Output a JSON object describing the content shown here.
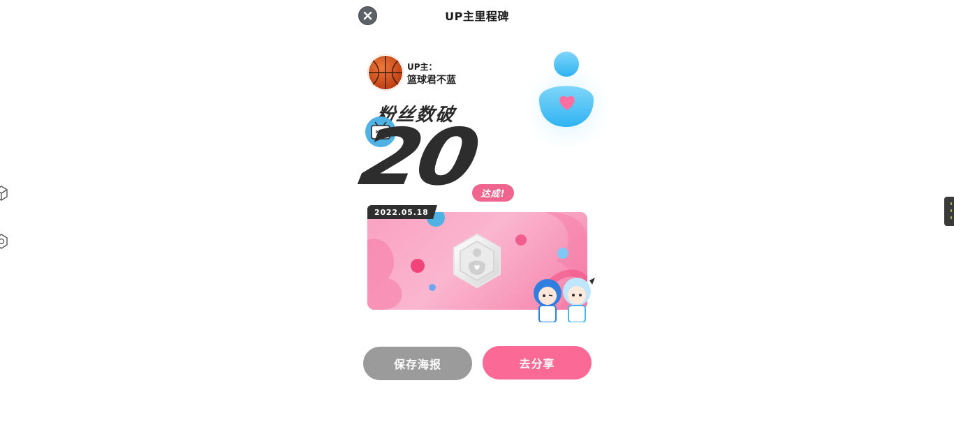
{
  "header": {
    "title": "UP主里程碑"
  },
  "poster": {
    "up_label": "UP主：",
    "up_name": "篮球君不蓝",
    "headline": "粉丝数破",
    "milestone_number": "20",
    "achieved_label": "达成!",
    "date": "2022.05.18"
  },
  "actions": {
    "save_label": "保存海报",
    "share_label": "去分享"
  },
  "colors": {
    "share_button": "#fb6a97",
    "save_button": "#9b9b9b",
    "card_pink": "#f9a0c0",
    "fan_icon_blue": "#5cc8f5"
  },
  "icons": [
    "close-icon",
    "basketball-avatar",
    "fan-heart-figure",
    "tv-mascot-icon",
    "hexagon-fan-medal-icon",
    "cube-icon",
    "hexagon-outline-icon"
  ]
}
